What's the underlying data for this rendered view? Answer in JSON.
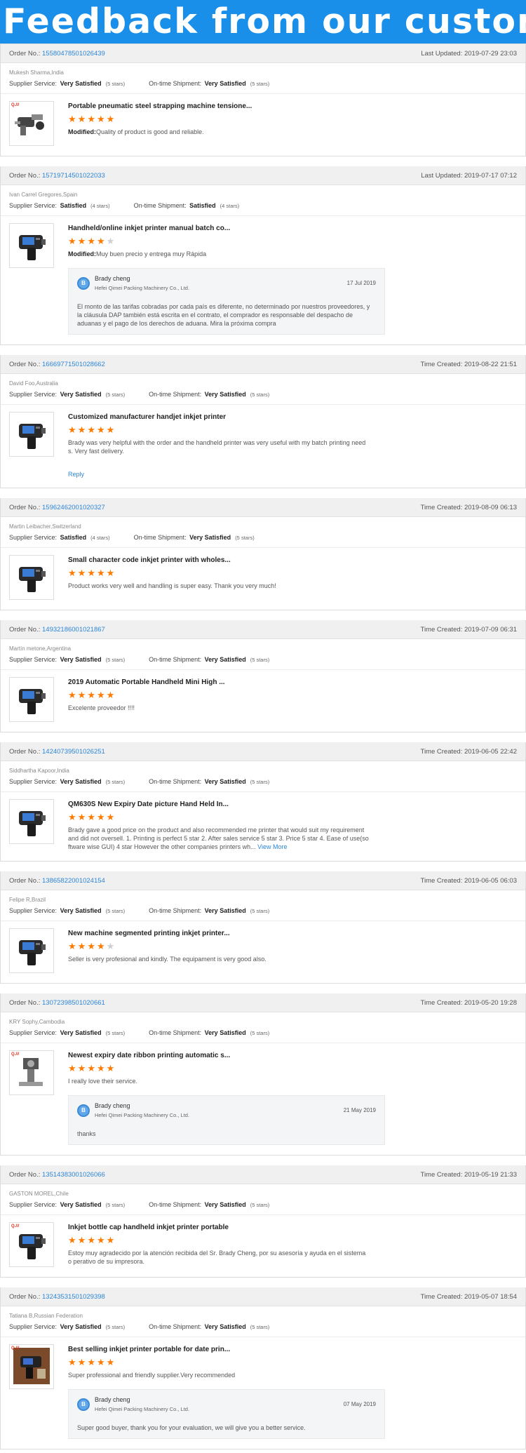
{
  "banner": {
    "title": "Feedback from our customers"
  },
  "feedbacks": [
    {
      "order_label": "Order No.:",
      "order_no": "15580478501026439",
      "time_label": "Last Updated:",
      "time": "2019-07-29 23:03",
      "buyer": "Mukesh Sharma,India",
      "supplier_label": "Supplier Service:",
      "supplier_value": "Very Satisfied",
      "supplier_stars": "(5 stars)",
      "shipment_label": "On-time Shipment:",
      "shipment_value": "Very Satisfied",
      "shipment_stars": "(5 stars)",
      "product_title": "Portable pneumatic steel strapping machine tensione...",
      "rating": 5,
      "comment_prefix": "Modified:",
      "comment": "Quality of product is good and reliable.",
      "badge": "Q.///",
      "product_icon": "strapping-machine-icon"
    },
    {
      "order_label": "Order No.:",
      "order_no": "15719714501022033",
      "time_label": "Last Updated:",
      "time": "2019-07-17 07:12",
      "buyer": "Ivan Carrel Gregores,Spain",
      "supplier_label": "Supplier Service:",
      "supplier_value": "Satisfied",
      "supplier_stars": "(4 stars)",
      "shipment_label": "On-time Shipment:",
      "shipment_value": "Satisfied",
      "shipment_stars": "(4 stars)",
      "product_title": "Handheld/online inkjet printer manual batch co...",
      "rating": 4,
      "comment_prefix": "Modified:",
      "comment": "Muy buen precio y entrega muy Rápida",
      "product_icon": "handheld-printer-icon",
      "reply": {
        "name": "Brady cheng",
        "company": "Hefei Qimei Packing Machinery Co., Ltd.",
        "date": "17 Jul 2019",
        "body": "El monto de las tarifas cobradas por cada país es diferente, no determinado por nuestros proveedores, y la cláusula DAP también está escrita en el contrato, el comprador es responsable del despacho de aduanas y el pago de los derechos de aduana. Mira la próxima compra"
      }
    },
    {
      "order_label": "Order No.:",
      "order_no": "16669771501028662",
      "time_label": "Time Created:",
      "time": "2019-08-22 21:51",
      "buyer": "David Foo,Australia",
      "supplier_label": "Supplier Service:",
      "supplier_value": "Very Satisfied",
      "supplier_stars": "(5 stars)",
      "shipment_label": "On-time Shipment:",
      "shipment_value": "Very Satisfied",
      "shipment_stars": "(5 stars)",
      "product_title": "Customized manufacturer handjet inkjet printer",
      "rating": 5,
      "comment": "Brady was very helpful with the order and the handheld printer was very useful with my batch printing need s. Very fast delivery.",
      "reply_link": "Reply",
      "product_icon": "handheld-printer-icon"
    },
    {
      "order_label": "Order No.:",
      "order_no": "15962462001020327",
      "time_label": "Time Created:",
      "time": "2019-08-09 06:13",
      "buyer": "Martin Leibacher,Switzerland",
      "supplier_label": "Supplier Service:",
      "supplier_value": "Satisfied",
      "supplier_stars": "(4 stars)",
      "shipment_label": "On-time Shipment:",
      "shipment_value": "Very Satisfied",
      "shipment_stars": "(5 stars)",
      "product_title": "Small character code inkjet printer with wholes...",
      "rating": 5,
      "comment": "Product works very well and handling is super easy. Thank you very much!",
      "product_icon": "handheld-printer-icon"
    },
    {
      "order_label": "Order No.:",
      "order_no": "14932186001021867",
      "time_label": "Time Created:",
      "time": "2019-07-09 06:31",
      "buyer": "Martín metone,Argentina",
      "supplier_label": "Supplier Service:",
      "supplier_value": "Very Satisfied",
      "supplier_stars": "(5 stars)",
      "shipment_label": "On-time Shipment:",
      "shipment_value": "Very Satisfied",
      "shipment_stars": "(5 stars)",
      "product_title": "2019 Automatic Portable Handheld Mini High ...",
      "rating": 5,
      "comment": "Excelente proveedor !!!!",
      "product_icon": "handheld-printer-icon"
    },
    {
      "order_label": "Order No.:",
      "order_no": "14240739501026251",
      "time_label": "Time Created:",
      "time": "2019-06-05 22:42",
      "buyer": "Siddhartha Kapoor,India",
      "supplier_label": "Supplier Service:",
      "supplier_value": "Very Satisfied",
      "supplier_stars": "(5 stars)",
      "shipment_label": "On-time Shipment:",
      "shipment_value": "Very Satisfied",
      "shipment_stars": "(5 stars)",
      "product_title": "QM630S New Expiry Date picture Hand Held In...",
      "rating": 5,
      "comment": "Brady gave a good price on the product and also recommended me printer that would suit my requirement and did not oversell. 1. Printing is perfect 5 star 2. After sales service 5 star 3. Price 5 star 4. Ease of use(so ftware wise GUI) 4 star However the other companies printers wh...",
      "view_more": "View More",
      "product_icon": "handheld-printer-icon"
    },
    {
      "order_label": "Order No.:",
      "order_no": "13865822001024154",
      "time_label": "Time Created:",
      "time": "2019-06-05 06:03",
      "buyer": "Felipe R,Brazil",
      "supplier_label": "Supplier Service:",
      "supplier_value": "Very Satisfied",
      "supplier_stars": "(5 stars)",
      "shipment_label": "On-time Shipment:",
      "shipment_value": "Very Satisfied",
      "shipment_stars": "(5 stars)",
      "product_title": "New machine segmented printing inkjet printer...",
      "rating": 4,
      "comment": "Seller is very profesional and kindly. The equipament is very good also.",
      "product_icon": "handheld-printer-icon"
    },
    {
      "order_label": "Order No.:",
      "order_no": "13072398501020661",
      "time_label": "Time Created:",
      "time": "2019-05-20 19:28",
      "buyer": "KRY Sophy,Cambodia",
      "supplier_label": "Supplier Service:",
      "supplier_value": "Very Satisfied",
      "supplier_stars": "(5 stars)",
      "shipment_label": "On-time Shipment:",
      "shipment_value": "Very Satisfied",
      "shipment_stars": "(5 stars)",
      "product_title": "Newest expiry date ribbon printing automatic s...",
      "rating": 5,
      "comment": "I really love their service.",
      "badge": "Q.///",
      "product_icon": "ribbon-printer-icon",
      "reply": {
        "name": "Brady cheng",
        "company": "Hefei Qimei Packing Machinery Co., Ltd.",
        "date": "21 May 2019",
        "body": "thanks"
      }
    },
    {
      "order_label": "Order No.:",
      "order_no": "13514383001026066",
      "time_label": "Time Created:",
      "time": "2019-05-19 21:33",
      "buyer": "GASTON MOREL,Chile",
      "supplier_label": "Supplier Service:",
      "supplier_value": "Very Satisfied",
      "supplier_stars": "(5 stars)",
      "shipment_label": "On-time Shipment:",
      "shipment_value": "Very Satisfied",
      "shipment_stars": "(5 stars)",
      "product_title": "Inkjet bottle cap handheld inkjet printer portable",
      "rating": 5,
      "comment": "Estoy muy agradecido por la atención recibida del Sr. Brady Cheng, por su asesoría y ayuda en el sistema o perativo de su impresora.",
      "badge": "Q.///",
      "product_icon": "handheld-printer-icon"
    },
    {
      "order_label": "Order No.:",
      "order_no": "13243531501029398",
      "time_label": "Time Created:",
      "time": "2019-05-07 18:54",
      "buyer": "Tatiana B,Russian Federation",
      "supplier_label": "Supplier Service:",
      "supplier_value": "Very Satisfied",
      "supplier_stars": "(5 stars)",
      "shipment_label": "On-time Shipment:",
      "shipment_value": "Very Satisfied",
      "shipment_stars": "(5 stars)",
      "product_title": "Best selling inkjet printer portable for date prin...",
      "rating": 5,
      "comment": "Super professional and friendly supplier.Very recommended",
      "badge": "Q.///",
      "product_icon": "handheld-printer-photo-icon",
      "reply": {
        "name": "Brady cheng",
        "company": "Hefei Qimei Packing Machinery Co., Ltd.",
        "date": "07 May 2019",
        "body": "Super good buyer, thank you for your evaluation, we will give you a better service."
      }
    }
  ],
  "colors": {
    "banner": "#1a8fea",
    "link": "#2d86d8",
    "star": "#ff7a00",
    "star_empty": "#cfcfcf"
  },
  "avatar_initial": "B"
}
